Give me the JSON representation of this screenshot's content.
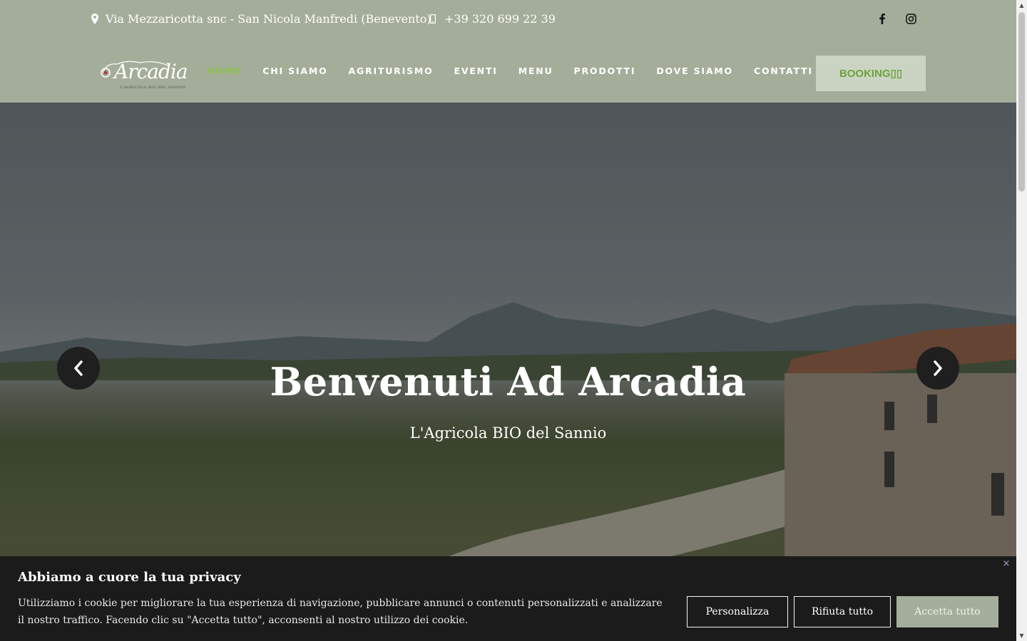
{
  "topbar": {
    "address": "Via Mezzaricotta snc - San Nicola Manfredi (Benevento)",
    "phone": "+39 320 699 22 39",
    "social_icons": [
      "facebook-icon",
      "instagram-icon"
    ]
  },
  "logo": {
    "text": "Arcadia",
    "tagline": "L'AGRICOLA BIO DEL SANNIO"
  },
  "nav": {
    "items": [
      "HOME",
      "CHI SIAMO",
      "AGRITURISMO",
      "EVENTI",
      "MENU",
      "PRODOTTI",
      "DOVE SIAMO",
      "CONTATTI"
    ],
    "active": "HOME",
    "booking_label": "BOOKING▯▯"
  },
  "hero": {
    "title": "Benvenuti Ad Arcadia",
    "subtitle": "L'Agricola BIO del Sannio",
    "prev_icon": "chevron-left-icon",
    "next_icon": "chevron-right-icon"
  },
  "cookie": {
    "title": "Abbiamo a cuore la tua privacy",
    "text": "Utilizziamo i cookie per migliorare la tua esperienza di navigazione, pubblicare annunci o contenuti personalizzati e analizzare il nostro traffico. Facendo clic su \"Accetta tutto\", acconsenti al nostro utilizzo dei cookie.",
    "customize_label": "Personalizza",
    "reject_label": "Rifiuta tutto",
    "accept_label": "Accetta tutto",
    "close_symbol": "×"
  },
  "colors": {
    "header_bg": "#a4ad99",
    "nav_active": "#8bc34a",
    "booking_bg": "#cbd4c3",
    "booking_text": "#6ea33d",
    "cookie_bg": "#1b1b1b",
    "accept_bg": "#a4ad99"
  }
}
